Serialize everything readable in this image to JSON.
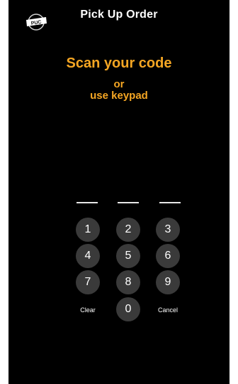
{
  "app": {
    "title": "Pick Up Order",
    "logo_text": "PUC"
  },
  "prompt": {
    "main": "Scan your code",
    "or": "or",
    "alt": "use keypad"
  },
  "code": {
    "slots": [
      "",
      "",
      ""
    ]
  },
  "keypad": {
    "keys": [
      "1",
      "2",
      "3",
      "4",
      "5",
      "6",
      "7",
      "8",
      "9"
    ],
    "clear_label": "Clear",
    "zero_label": "0",
    "cancel_label": "Cancel"
  },
  "colors": {
    "background": "#000000",
    "accent": "#f5a623",
    "key_fill": "#3a3a3a",
    "text": "#ffffff"
  },
  "icons": {
    "logo": "puc-logo-icon"
  }
}
